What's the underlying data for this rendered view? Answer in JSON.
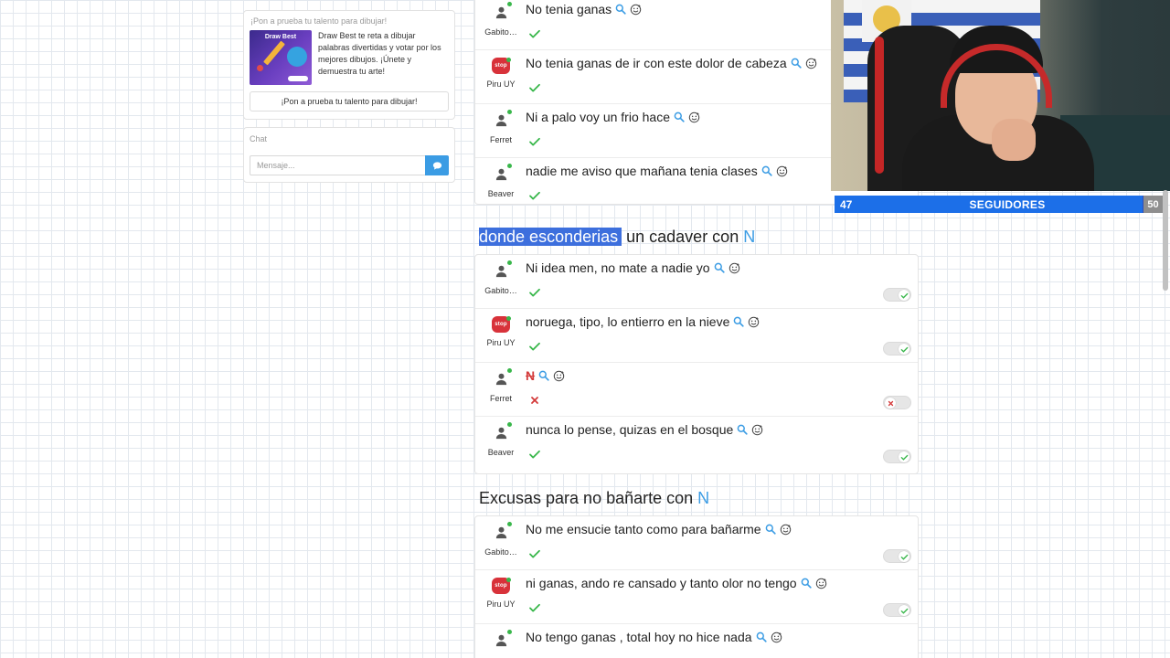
{
  "sidebar": {
    "promo": {
      "title": "¡Pon a prueba tu talento para dibujar!",
      "image_title": "Draw Best",
      "description": "Draw Best te reta a dibujar palabras divertidas y votar por los mejores dibujos. ¡Únete y demuestra tu arte!",
      "button_label": "¡Pon a prueba tu talento para dibujar!"
    },
    "chat": {
      "title": "Chat",
      "placeholder": "Mensaje...",
      "send_icon": "chat-bubble-icon"
    }
  },
  "top_card": {
    "entries": [
      {
        "user": "Gabito…",
        "avatar": "user-icon",
        "answer": "No tenia ganas",
        "status": "valid"
      },
      {
        "user": "Piru UY",
        "avatar": "stop-icon",
        "avatar_text": "stop",
        "answer": "No tenia ganas de ir con este dolor de cabeza",
        "status": "valid"
      },
      {
        "user": "Ferret",
        "avatar": "user-icon",
        "answer": "Ni a palo voy un frio hace",
        "status": "valid"
      },
      {
        "user": "Beaver",
        "avatar": "user-icon",
        "answer": "nadie me aviso que mañana tenia clases",
        "status": "valid"
      }
    ]
  },
  "categories": [
    {
      "title_highlighted": "donde esconderias",
      "title_rest": " un cadaver con ",
      "letter": "N",
      "entries": [
        {
          "user": "Gabito…",
          "avatar": "user-icon",
          "answer": "Ni idea men, no mate a nadie yo",
          "status": "valid",
          "vote": "on"
        },
        {
          "user": "Piru UY",
          "avatar": "stop-icon",
          "avatar_text": "stop",
          "answer": "noruega, tipo, lo entierro en la nieve",
          "status": "valid",
          "vote": "on"
        },
        {
          "user": "Ferret",
          "avatar": "user-icon",
          "answer": "N",
          "status": "invalid",
          "vote": "off"
        },
        {
          "user": "Beaver",
          "avatar": "user-icon",
          "answer": "nunca lo pense, quizas en el bosque",
          "status": "valid",
          "vote": "on"
        }
      ]
    },
    {
      "title": "Excusas para no bañarte con ",
      "letter": "N",
      "entries": [
        {
          "user": "Gabito…",
          "avatar": "user-icon",
          "answer": "No me ensucie tanto como para bañarme",
          "status": "valid",
          "vote": "on"
        },
        {
          "user": "Piru UY",
          "avatar": "stop-icon",
          "avatar_text": "stop",
          "answer": "ni ganas, ando re cansado y tanto olor no tengo",
          "status": "valid",
          "vote": "on"
        },
        {
          "user": "",
          "avatar": "user-icon",
          "answer": "No tengo ganas , total hoy no hice nada",
          "status": "",
          "vote": "on"
        }
      ]
    }
  ],
  "stream_overlay": {
    "followers_current": "47",
    "followers_label": "SEGUIDORES",
    "followers_goal": "50",
    "progress_fraction": 0.94
  },
  "colors": {
    "accent": "#3b9ce4",
    "valid": "#39b74b",
    "invalid": "#d33a3a",
    "highlight": "#3d6fdd",
    "follower_bar": "#1c6fe8"
  }
}
